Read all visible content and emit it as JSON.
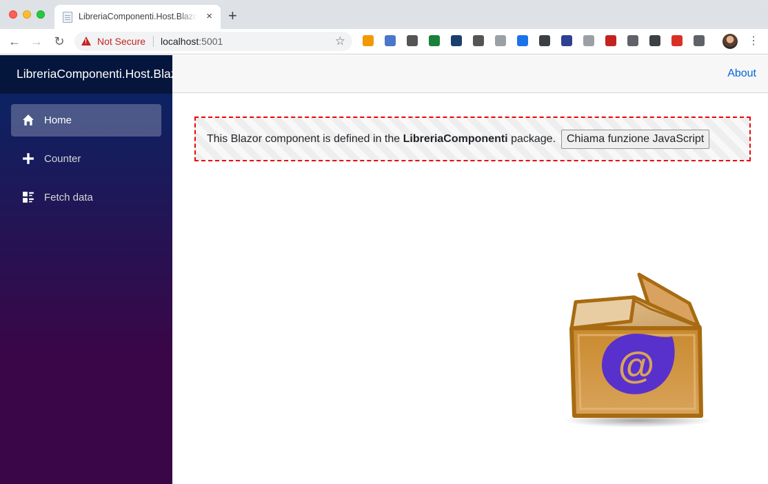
{
  "browser": {
    "tab_title": "LibreriaComponenti.Host.Blazor",
    "tab_close": "×",
    "new_tab": "+",
    "security_label": "Not Secure",
    "url_host": "localhost",
    "url_port": ":5001",
    "nav": {
      "back": "←",
      "forward": "→",
      "reload": "↻"
    },
    "star": "☆",
    "menu": "⋮",
    "extension_icons": [
      "rss-icon",
      "tampermonkey-icon",
      "dark-icon",
      "sheets-icon",
      "git-icon",
      "moon-icon",
      "screen-icon",
      "calendar-icon",
      "braces-icon",
      "zotero-icon",
      "timer-icon",
      "cors-icon",
      "code-icon",
      "info-icon",
      "media-icon",
      "cube-icon"
    ],
    "extension_colors": [
      "#f29900",
      "#4a77c8",
      "#555555",
      "#188038",
      "#1a3e6e",
      "#555555",
      "#9aa0a6",
      "#1a73e8",
      "#3c4043",
      "#2e4190",
      "#9aa0a6",
      "#c5221f",
      "#5f6368",
      "#3c4043",
      "#d93025",
      "#5f6368"
    ]
  },
  "app": {
    "brand": "LibreriaComponenti.Host.Blazor",
    "nav_items": [
      {
        "label": "Home",
        "icon": "home-icon",
        "active": true
      },
      {
        "label": "Counter",
        "icon": "plus-icon",
        "active": false
      },
      {
        "label": "Fetch data",
        "icon": "list-rich-icon",
        "active": false
      }
    ],
    "about_link": "About",
    "component": {
      "text_before": "This Blazor component is defined in the ",
      "text_bold": "LibreriaComponenti",
      "text_after": " package.",
      "button_label": "Chiama funzione JavaScript"
    },
    "image": {
      "name": "blazor-package-box",
      "logo_glyph": "@"
    }
  },
  "colors": {
    "sidebar_top": "#052767",
    "sidebar_bottom": "#3a0647",
    "link": "#0366d6",
    "component_border": "#ee0000",
    "not_secure": "#c5221f"
  }
}
